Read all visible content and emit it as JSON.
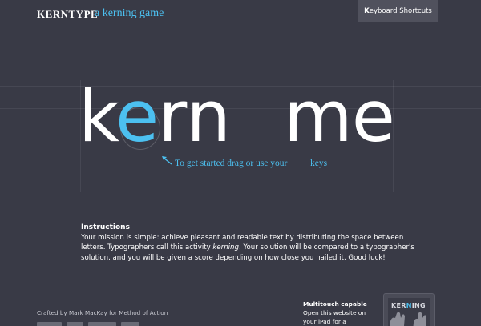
{
  "header": {
    "logo": "KERNTYPE",
    "tagline": "a kerning game",
    "shortcuts_first": "K",
    "shortcuts_rest": "eyboard Shortcuts"
  },
  "game": {
    "letters": [
      {
        "char": "k",
        "active": false
      },
      {
        "char": "e",
        "active": true
      },
      {
        "char": "r",
        "active": false
      },
      {
        "char": "n",
        "active": false
      }
    ],
    "letters2": [
      {
        "char": "m",
        "active": false
      },
      {
        "char": "e",
        "active": false
      }
    ],
    "hint": "To get started drag or use your",
    "hint_keys": "keys"
  },
  "instructions": {
    "title": "Instructions",
    "line_a": "Your mission is simple: achieve pleasant and readable text by distributing the space between letters. Typographers call this activity ",
    "emph": "kerning",
    "line_b": ". Your solution will be compared to a typographer's solution, and you will be given a score depending on how close you nailed it. Good luck!"
  },
  "footer": {
    "crafted_by": "Crafted by",
    "author": "Mark MacKay",
    "for_text": "for",
    "company": "Method of Action"
  },
  "multitouch": {
    "title": "Multitouch capable",
    "line1": "Open this website on",
    "line2": "your iPad for a",
    "promo_word_a": "KER",
    "promo_word_n": "N",
    "promo_word_b": "ING"
  },
  "colors": {
    "background": "#393a46",
    "accent": "#4cc0f0",
    "button": "#50515d"
  },
  "icons": {
    "hint_arrow": "arrow-up-left-icon",
    "hands": "hands-icon"
  }
}
